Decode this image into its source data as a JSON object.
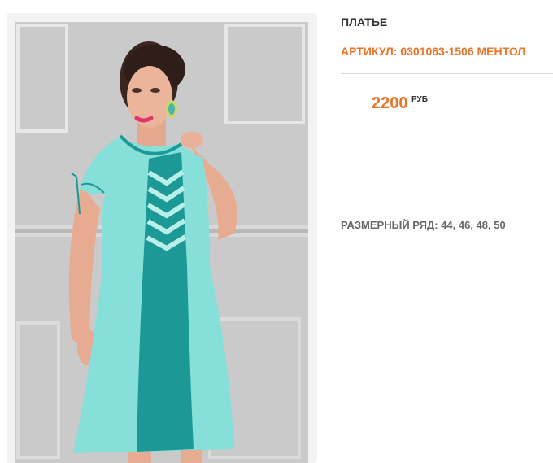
{
  "product": {
    "title": "ПЛАТЬЕ",
    "sku": "АРТИКУЛ: 0301063-1506 МЕНТОЛ",
    "price": "2200",
    "currency": "РУБ",
    "sizes": "РАЗМЕРНЫЙ РЯД: 44, 46, 48, 50",
    "image": {
      "icon": "product-photo",
      "colors": {
        "dress_light": "#86dfd8",
        "dress_dark": "#1c9895",
        "wall": "#bcbcbc"
      }
    }
  },
  "colors": {
    "accent": "#e8762b",
    "text_dark": "#333333",
    "text_muted": "#666666"
  }
}
